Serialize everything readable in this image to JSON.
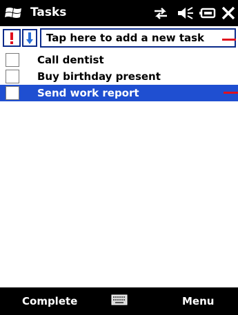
{
  "titlebar": {
    "title": "Tasks",
    "icons": [
      "windows-start-icon",
      "connectivity-icon",
      "volume-icon",
      "battery-icon",
      "close-icon"
    ]
  },
  "entry": {
    "priority_icon": "exclamation-icon",
    "sort_icon": "down-arrow-icon",
    "placeholder": "Tap here to add a new task"
  },
  "tasks": [
    {
      "label": "Call dentist",
      "checked": false,
      "selected": false
    },
    {
      "label": "Buy birthday present",
      "checked": false,
      "selected": false
    },
    {
      "label": "Send work report",
      "checked": false,
      "selected": true
    }
  ],
  "menubar": {
    "left_softkey": "Complete",
    "keyboard_icon": "keyboard-icon",
    "right_softkey": "Menu"
  },
  "colors": {
    "titlebar_bg": "#000000",
    "selection": "#1f4fd1",
    "border_accent": "#0a2a8a",
    "marker_red": "#e0101e"
  }
}
